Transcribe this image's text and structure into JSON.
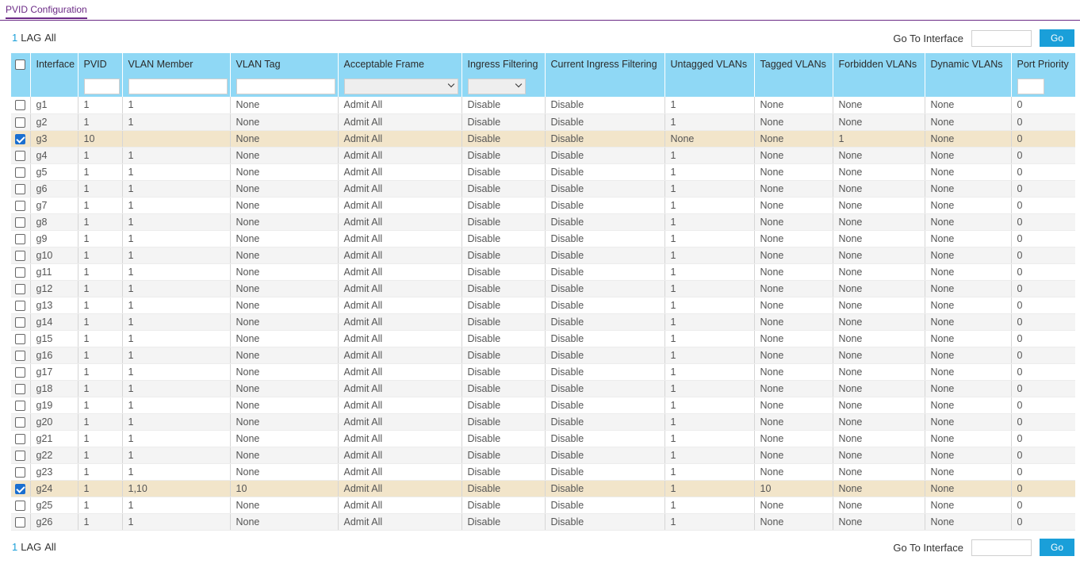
{
  "tab": {
    "label": "PVID Configuration"
  },
  "nav": {
    "lag_number": "1",
    "lag_label": "LAG",
    "all_label": "All",
    "goto_label": "Go To Interface",
    "go_button": "Go"
  },
  "table": {
    "headers": [
      "Interface",
      "PVID",
      "VLAN Member",
      "VLAN Tag",
      "Acceptable Frame",
      "Ingress Filtering",
      "Current Ingress Filtering",
      "Untagged VLANs",
      "Tagged VLANs",
      "Forbidden VLANs",
      "Dynamic VLANs",
      "Port Priority"
    ],
    "rows": [
      {
        "checked": false,
        "cells": [
          "g1",
          "1",
          "1",
          "None",
          "Admit All",
          "Disable",
          "Disable",
          "1",
          "None",
          "None",
          "None",
          "0"
        ]
      },
      {
        "checked": false,
        "cells": [
          "g2",
          "1",
          "1",
          "None",
          "Admit All",
          "Disable",
          "Disable",
          "1",
          "None",
          "None",
          "None",
          "0"
        ]
      },
      {
        "checked": true,
        "cells": [
          "g3",
          "10",
          "",
          "None",
          "Admit All",
          "Disable",
          "Disable",
          "None",
          "None",
          "1",
          "None",
          "0"
        ]
      },
      {
        "checked": false,
        "cells": [
          "g4",
          "1",
          "1",
          "None",
          "Admit All",
          "Disable",
          "Disable",
          "1",
          "None",
          "None",
          "None",
          "0"
        ]
      },
      {
        "checked": false,
        "cells": [
          "g5",
          "1",
          "1",
          "None",
          "Admit All",
          "Disable",
          "Disable",
          "1",
          "None",
          "None",
          "None",
          "0"
        ]
      },
      {
        "checked": false,
        "cells": [
          "g6",
          "1",
          "1",
          "None",
          "Admit All",
          "Disable",
          "Disable",
          "1",
          "None",
          "None",
          "None",
          "0"
        ]
      },
      {
        "checked": false,
        "cells": [
          "g7",
          "1",
          "1",
          "None",
          "Admit All",
          "Disable",
          "Disable",
          "1",
          "None",
          "None",
          "None",
          "0"
        ]
      },
      {
        "checked": false,
        "cells": [
          "g8",
          "1",
          "1",
          "None",
          "Admit All",
          "Disable",
          "Disable",
          "1",
          "None",
          "None",
          "None",
          "0"
        ]
      },
      {
        "checked": false,
        "cells": [
          "g9",
          "1",
          "1",
          "None",
          "Admit All",
          "Disable",
          "Disable",
          "1",
          "None",
          "None",
          "None",
          "0"
        ]
      },
      {
        "checked": false,
        "cells": [
          "g10",
          "1",
          "1",
          "None",
          "Admit All",
          "Disable",
          "Disable",
          "1",
          "None",
          "None",
          "None",
          "0"
        ]
      },
      {
        "checked": false,
        "cells": [
          "g11",
          "1",
          "1",
          "None",
          "Admit All",
          "Disable",
          "Disable",
          "1",
          "None",
          "None",
          "None",
          "0"
        ]
      },
      {
        "checked": false,
        "cells": [
          "g12",
          "1",
          "1",
          "None",
          "Admit All",
          "Disable",
          "Disable",
          "1",
          "None",
          "None",
          "None",
          "0"
        ]
      },
      {
        "checked": false,
        "cells": [
          "g13",
          "1",
          "1",
          "None",
          "Admit All",
          "Disable",
          "Disable",
          "1",
          "None",
          "None",
          "None",
          "0"
        ]
      },
      {
        "checked": false,
        "cells": [
          "g14",
          "1",
          "1",
          "None",
          "Admit All",
          "Disable",
          "Disable",
          "1",
          "None",
          "None",
          "None",
          "0"
        ]
      },
      {
        "checked": false,
        "cells": [
          "g15",
          "1",
          "1",
          "None",
          "Admit All",
          "Disable",
          "Disable",
          "1",
          "None",
          "None",
          "None",
          "0"
        ]
      },
      {
        "checked": false,
        "cells": [
          "g16",
          "1",
          "1",
          "None",
          "Admit All",
          "Disable",
          "Disable",
          "1",
          "None",
          "None",
          "None",
          "0"
        ]
      },
      {
        "checked": false,
        "cells": [
          "g17",
          "1",
          "1",
          "None",
          "Admit All",
          "Disable",
          "Disable",
          "1",
          "None",
          "None",
          "None",
          "0"
        ]
      },
      {
        "checked": false,
        "cells": [
          "g18",
          "1",
          "1",
          "None",
          "Admit All",
          "Disable",
          "Disable",
          "1",
          "None",
          "None",
          "None",
          "0"
        ]
      },
      {
        "checked": false,
        "cells": [
          "g19",
          "1",
          "1",
          "None",
          "Admit All",
          "Disable",
          "Disable",
          "1",
          "None",
          "None",
          "None",
          "0"
        ]
      },
      {
        "checked": false,
        "cells": [
          "g20",
          "1",
          "1",
          "None",
          "Admit All",
          "Disable",
          "Disable",
          "1",
          "None",
          "None",
          "None",
          "0"
        ]
      },
      {
        "checked": false,
        "cells": [
          "g21",
          "1",
          "1",
          "None",
          "Admit All",
          "Disable",
          "Disable",
          "1",
          "None",
          "None",
          "None",
          "0"
        ]
      },
      {
        "checked": false,
        "cells": [
          "g22",
          "1",
          "1",
          "None",
          "Admit All",
          "Disable",
          "Disable",
          "1",
          "None",
          "None",
          "None",
          "0"
        ]
      },
      {
        "checked": false,
        "cells": [
          "g23",
          "1",
          "1",
          "None",
          "Admit All",
          "Disable",
          "Disable",
          "1",
          "None",
          "None",
          "None",
          "0"
        ]
      },
      {
        "checked": true,
        "cells": [
          "g24",
          "1",
          "1,10",
          "10",
          "Admit All",
          "Disable",
          "Disable",
          "1",
          "10",
          "None",
          "None",
          "0"
        ]
      },
      {
        "checked": false,
        "cells": [
          "g25",
          "1",
          "1",
          "None",
          "Admit All",
          "Disable",
          "Disable",
          "1",
          "None",
          "None",
          "None",
          "0"
        ]
      },
      {
        "checked": false,
        "cells": [
          "g26",
          "1",
          "1",
          "None",
          "Admit All",
          "Disable",
          "Disable",
          "1",
          "None",
          "None",
          "None",
          "0"
        ]
      }
    ]
  },
  "colors": {
    "accent": "#6b2a86",
    "header_bg": "#8fd8f5",
    "selected_row": "#f2e5ca",
    "button": "#1a9fd9",
    "checkbox_checked": "#1a6fd0"
  }
}
